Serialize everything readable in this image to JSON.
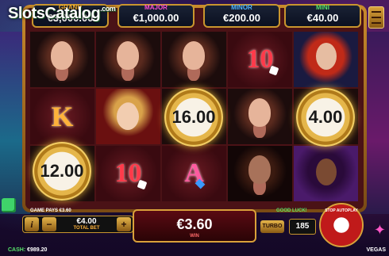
{
  "jackpots": [
    {
      "name": "GRAND",
      "value": "€3,000.00"
    },
    {
      "name": "MAJOR",
      "value": "€1,000.00"
    },
    {
      "name": "MINOR",
      "value": "€200.00"
    },
    {
      "name": "MINI",
      "value": "€40.00"
    }
  ],
  "watermark": {
    "text": "SlotsCatalog",
    "suffix": ".com"
  },
  "reels": {
    "grid": [
      [
        "lady",
        "lady",
        "lady",
        "10",
        "red-hair-lady"
      ],
      [
        "K",
        "queen",
        "chip",
        "lady",
        "chip"
      ],
      [
        "chip",
        "10",
        "A",
        "dark-lady",
        "purple-lady"
      ]
    ],
    "chips": [
      "12.00",
      "16.00",
      "4.00"
    ]
  },
  "symbols": {
    "ten": "10",
    "king": "K",
    "ace": "A"
  },
  "status": {
    "game_pays": "GAME PAYS €3.60",
    "good_luck": "GOOD LUCK!"
  },
  "bet": {
    "value": "€4.00",
    "label": "TOTAL BET",
    "info": "i",
    "minus": "−",
    "plus": "+"
  },
  "win": {
    "value": "€3.60",
    "label": "WIN"
  },
  "turbo": {
    "label": "TURBO"
  },
  "autoplay": {
    "remaining": "185",
    "label": "STOP AUTOPLAY"
  },
  "cash": {
    "label": "CASH:",
    "value": "€989.20"
  },
  "brand": "VEGAS"
}
